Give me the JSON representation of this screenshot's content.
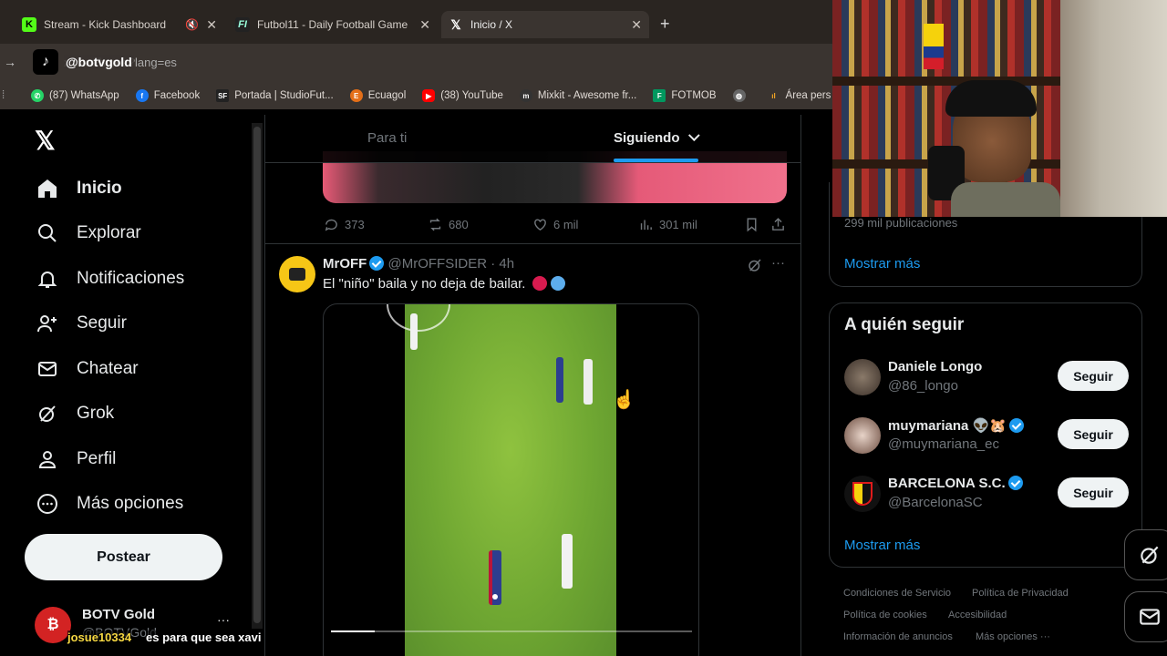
{
  "browser": {
    "tabs": [
      {
        "title": "Stream - Kick Dashboard",
        "icon": "K"
      },
      {
        "title": "Futbol11 - Daily Football Game",
        "icon": "F"
      },
      {
        "title": "Inicio / X",
        "icon": "X"
      }
    ],
    "url": "x.com/home?lang=es",
    "bookmarks": [
      "(87) WhatsApp",
      "Facebook",
      "Portada | StudioFut...",
      "Ecuagol",
      "(38) YouTube",
      "Mixkit - Awesome fr...",
      "FOTMOB",
      "",
      "Área pers"
    ]
  },
  "overlay": {
    "tiktok_handle": "@botvgold",
    "chat_user": "josue10334",
    "chat_message": "es para que sea xavi"
  },
  "sidebar": {
    "items": [
      {
        "label": "Inicio",
        "icon": "home-icon"
      },
      {
        "label": "Explorar",
        "icon": "search-icon"
      },
      {
        "label": "Notificaciones",
        "icon": "bell-icon"
      },
      {
        "label": "Seguir",
        "icon": "add-user-icon"
      },
      {
        "label": "Chatear",
        "icon": "mail-icon"
      },
      {
        "label": "Grok",
        "icon": "grok-icon"
      },
      {
        "label": "Perfil",
        "icon": "person-icon"
      },
      {
        "label": "Más opciones",
        "icon": "more-circle-icon"
      }
    ],
    "post_button": "Postear",
    "account_name": "BOTV Gold",
    "account_handle": "@BOTVGold"
  },
  "feed": {
    "tabs": [
      "Para ti",
      "Siguiendo"
    ],
    "prev_tweet_actions": {
      "replies": "373",
      "reposts": "680",
      "likes": "6 mil",
      "views": "301 mil"
    },
    "tweet": {
      "author": "MrOFF",
      "handle": "@MrOFFSIDER",
      "time": "· 4h",
      "text": "El \"niño\" baila y no deja de bailar."
    }
  },
  "right": {
    "trend_count": "299 mil publicaciones",
    "show_more": "Mostrar más",
    "who_to_follow_title": "A quién seguir",
    "follow": [
      {
        "name": "Daniele Longo",
        "handle": "@86_longo",
        "button": "Seguir",
        "verified": false
      },
      {
        "name": "muymariana 👽🐹",
        "handle": "@muymariana_ec",
        "button": "Seguir",
        "verified": true
      },
      {
        "name": "BARCELONA S.C.",
        "handle": "@BarcelonaSC",
        "button": "Seguir",
        "verified": true
      }
    ],
    "show_more_2": "Mostrar más",
    "footer": [
      "Condiciones de Servicio",
      "Política de Privacidad",
      "Política de cookies",
      "Accesibilidad",
      "Información de anuncios",
      "Más opciones ···"
    ]
  },
  "colors": {
    "accent": "#1d9bf0",
    "bg": "#000000",
    "chrome": "#3a3430"
  }
}
